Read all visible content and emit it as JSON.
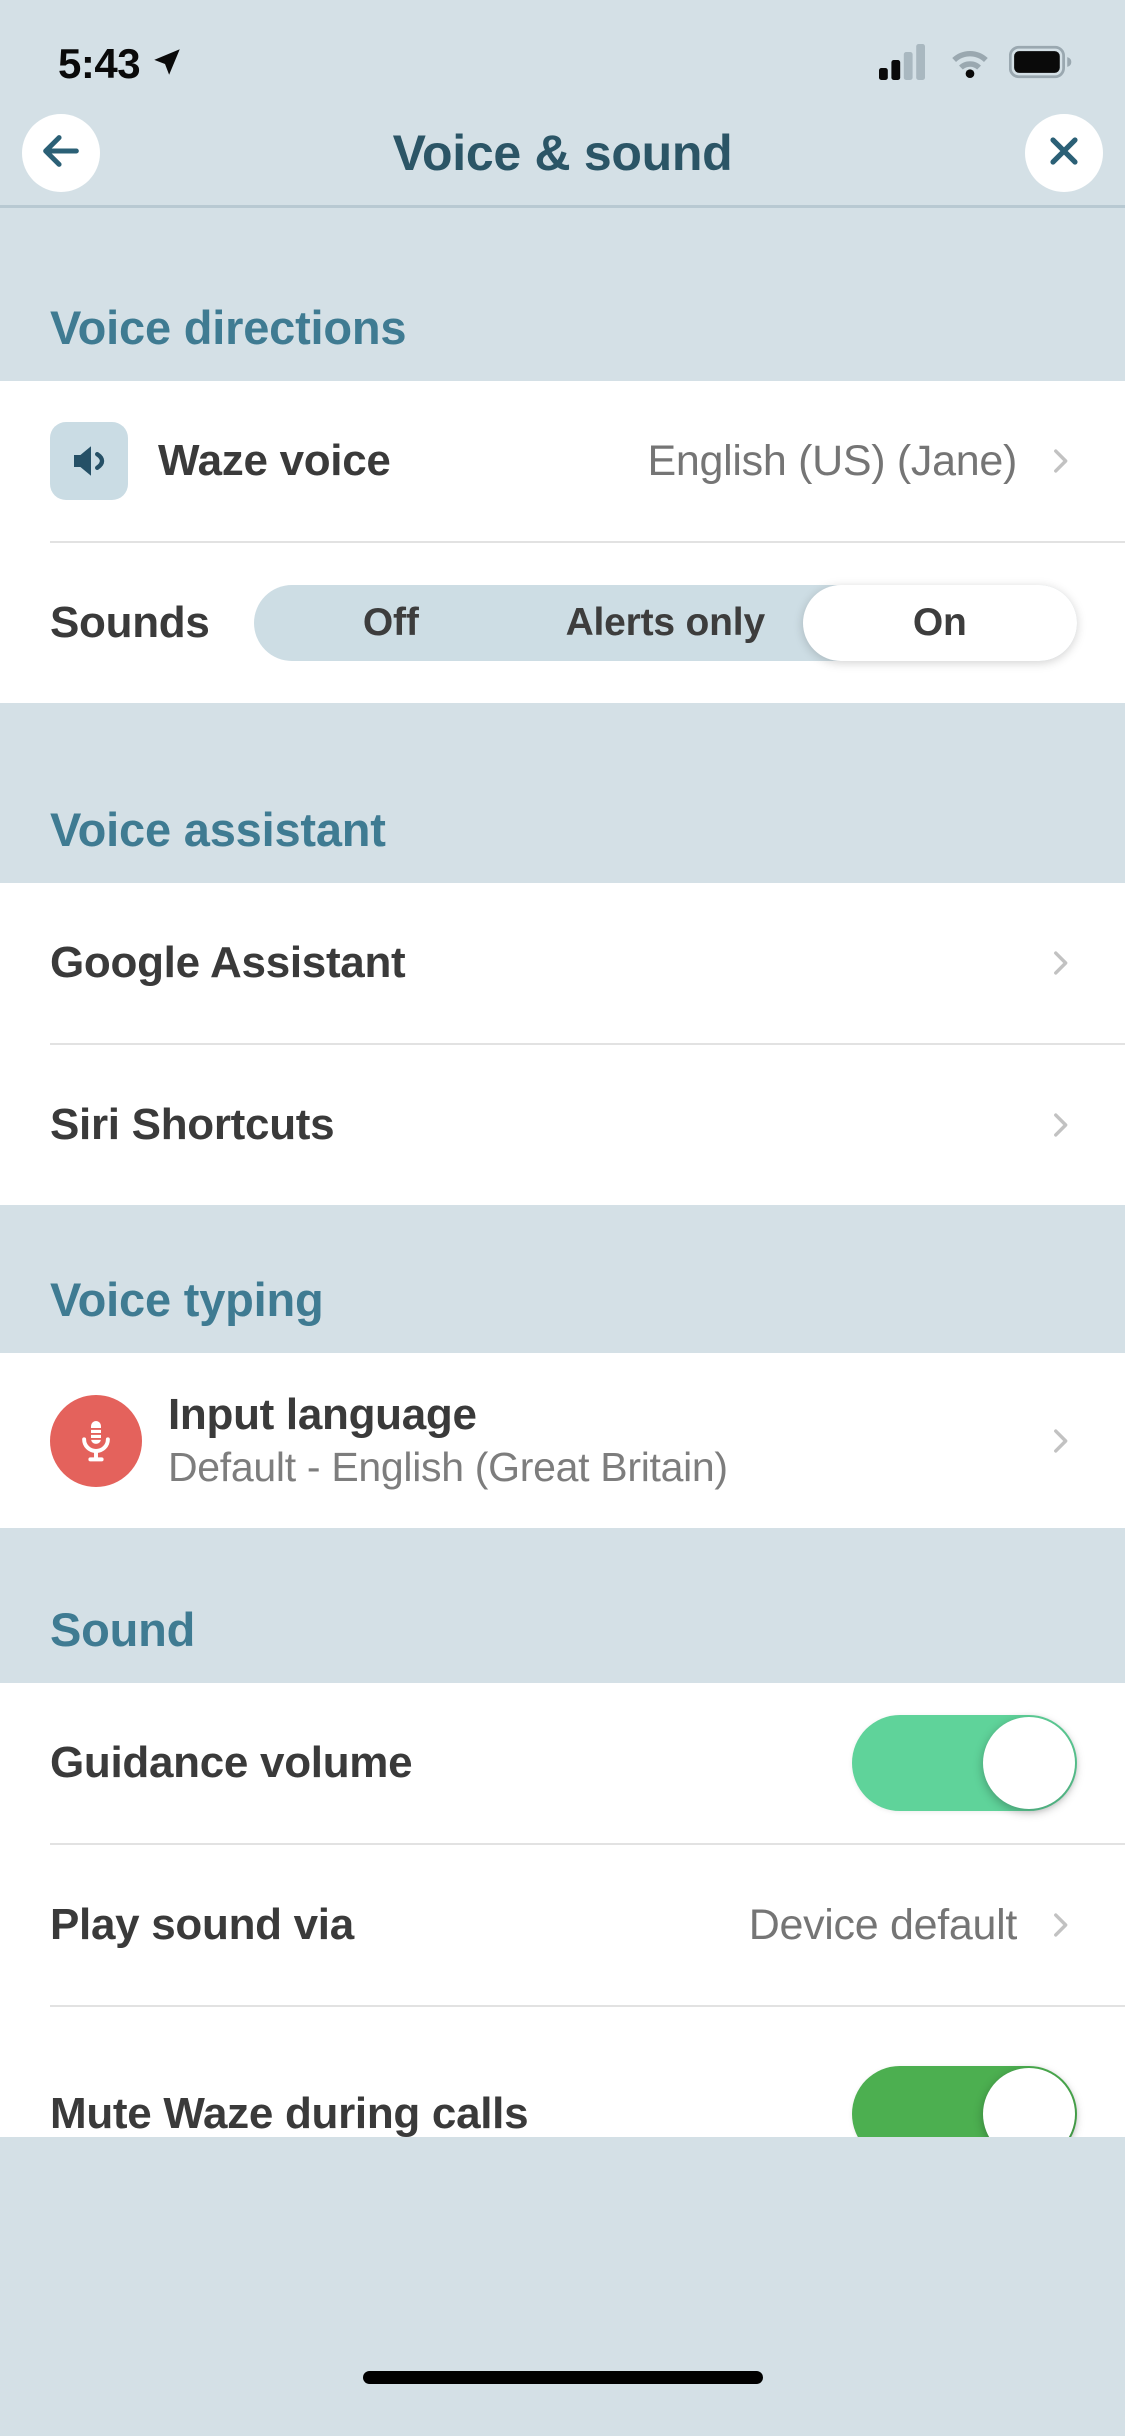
{
  "status_bar": {
    "time": "5:43",
    "location_icon": "location-arrow-icon",
    "cellular_icon": "cellular-signal-icon",
    "wifi_icon": "wifi-icon",
    "battery_icon": "battery-full-icon"
  },
  "header": {
    "title": "Voice & sound",
    "back_icon": "back-arrow-icon",
    "close_icon": "close-x-icon"
  },
  "sections": {
    "voice_directions": {
      "heading": "Voice directions",
      "waze_voice": {
        "label": "Waze voice",
        "value": "English (US) (Jane)",
        "icon": "speaker-icon",
        "chevron": "chevron-right-icon"
      },
      "sounds": {
        "label": "Sounds",
        "options": [
          "Off",
          "Alerts only",
          "On"
        ],
        "selected": "On"
      }
    },
    "voice_assistant": {
      "heading": "Voice assistant",
      "items": [
        {
          "label": "Google Assistant",
          "chevron": "chevron-right-icon"
        },
        {
          "label": "Siri Shortcuts",
          "chevron": "chevron-right-icon"
        }
      ]
    },
    "voice_typing": {
      "heading": "Voice typing",
      "input_language": {
        "label": "Input language",
        "value": "Default - English (Great Britain)",
        "icon": "microphone-icon",
        "chevron": "chevron-right-icon"
      }
    },
    "sound": {
      "heading": "Sound",
      "guidance_volume": {
        "label": "Guidance volume",
        "state": "on"
      },
      "play_sound_via": {
        "label": "Play sound via",
        "value": "Device default",
        "chevron": "chevron-right-icon"
      },
      "mute_during_calls": {
        "label": "Mute Waze during calls",
        "state": "on"
      }
    }
  },
  "colors": {
    "page_background": "#d4e0e6",
    "section_heading": "#3f7b92",
    "title_text": "#2b5566",
    "row_title": "#3a3a3a",
    "row_value": "#757575",
    "toggle_on": "#5fd39a",
    "mic_circle": "#e4625c",
    "icon_tile": "#cadce4",
    "segment_track": "#cddde4"
  }
}
